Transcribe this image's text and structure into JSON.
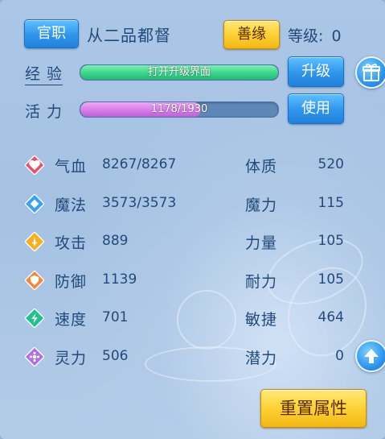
{
  "header": {
    "rank_button": "官职",
    "rank_title": "从二品都督",
    "karma_button": "善缘",
    "level_label": "等级",
    "level_sep": ":",
    "level_value": "0"
  },
  "experience": {
    "label": "经 验",
    "bar_text": "打开升级界面",
    "fill_fraction": 1.0,
    "upgrade_button": "升级"
  },
  "vitality": {
    "label": "活 力",
    "bar_text": "1178/1930",
    "current": 1178,
    "max": 1930,
    "use_button": "使用"
  },
  "stats": [
    {
      "icon": "heart-icon",
      "color": "#e8506a",
      "label": "气血",
      "value": "8267/8267",
      "attr_label": "体质",
      "attr_value": "520"
    },
    {
      "icon": "diamond-icon",
      "color": "#3aa0f0",
      "label": "魔法",
      "value": "3573/3573",
      "attr_label": "魔力",
      "attr_value": "115"
    },
    {
      "icon": "sword-icon",
      "color": "#f4b020",
      "label": "攻击",
      "value": "889",
      "attr_label": "力量",
      "attr_value": "105"
    },
    {
      "icon": "shield-icon",
      "color": "#f08a3a",
      "label": "防御",
      "value": "1139",
      "attr_label": "耐力",
      "attr_value": "105"
    },
    {
      "icon": "lightning-icon",
      "color": "#22c08a",
      "label": "速度",
      "value": "701",
      "attr_label": "敏捷",
      "attr_value": "464"
    },
    {
      "icon": "spirit-icon",
      "color": "#b070e0",
      "label": "灵力",
      "value": "506",
      "attr_label": "潜力",
      "attr_value": "0"
    }
  ],
  "reset_button": "重置属性",
  "colors": {
    "exp_bar": "#3fd88e",
    "vit_bar": "#d880e8",
    "panel": "#a6c2e3",
    "text": "#234a7a"
  }
}
